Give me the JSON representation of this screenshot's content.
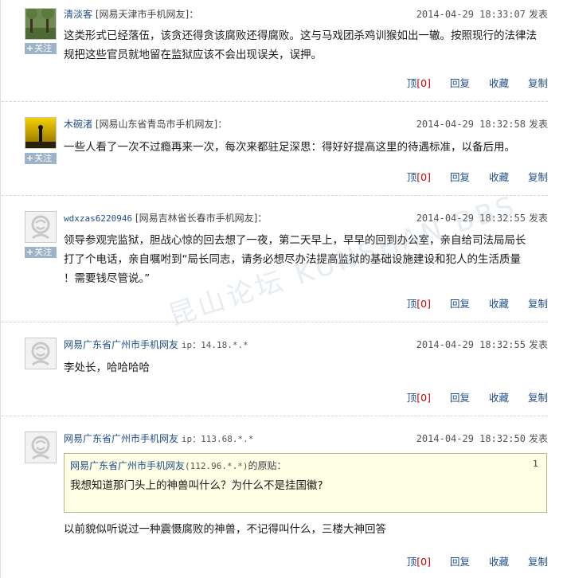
{
  "follow_label": "关注",
  "published_label": "发表",
  "actions": {
    "top": "顶",
    "top_count": "[0]",
    "reply": "回复",
    "favorite": "收藏",
    "copy": "复制"
  },
  "watermark": "昆山论坛 KUNSHAN BBS",
  "comments": [
    {
      "username": "清淡客",
      "location": "[网易天津市手机网友]：",
      "time": "2014-04-29 18:33:07",
      "avatar_icon": "landscape-avatar-icon",
      "text": "这类形式已经落伍，该贪还得贪该腐败还得腐败。这与马戏团杀鸡训猴如出一辙。按照现行的法律法规把这些官员就地留在监狱应该不会出现误关，误押。"
    },
    {
      "username": "木碗渚",
      "location": "[网易山东省青岛市手机网友]：",
      "time": "2014-04-29 18:32:58",
      "avatar_icon": "sunset-avatar-icon",
      "text": "一些人看了一次不过瘾再来一次，每次来都驻足深思：得好好提高这里的待遇标准，以备后用。"
    },
    {
      "username": "wdxzas6220946",
      "location": "[网易吉林省长春市手机网友]：",
      "time": "2014-04-29 18:32:55",
      "avatar_icon": "default-avatar-icon",
      "text_lines": [
        "领导参观完监狱，胆战心惊的回去想了一夜，第二天早上，早早的回到办公室，亲自给司法局局长",
        "打了个电话，亲自嘱咐到“局长同志，请务必想尽办法提高监狱的基础设施建设和犯人的生活质量",
        "！需要钱尽管说。”"
      ]
    },
    {
      "username": "网易广东省广州市手机网友",
      "ip": "ip：14.18.*.*",
      "time": "2014-04-29 18:32:55",
      "avatar_icon": "default-avatar-icon",
      "text": "李处长，哈哈哈哈"
    },
    {
      "username": "网易广东省广州市手机网友",
      "ip": "ip：113.68.*.*",
      "time": "2014-04-29 18:32:50",
      "avatar_icon": "default-avatar-icon",
      "quote": {
        "author": "网易广东省广州市手机网友",
        "ip": "(112.96.*.*)",
        "suffix": "的原贴：",
        "floor": "1",
        "text": "我想知道那门头上的神兽叫什么？为什么不是挂国徽?"
      },
      "text": "以前貌似听说过一种震慑腐败的神兽，不记得叫什么，三楼大神回答"
    }
  ]
}
